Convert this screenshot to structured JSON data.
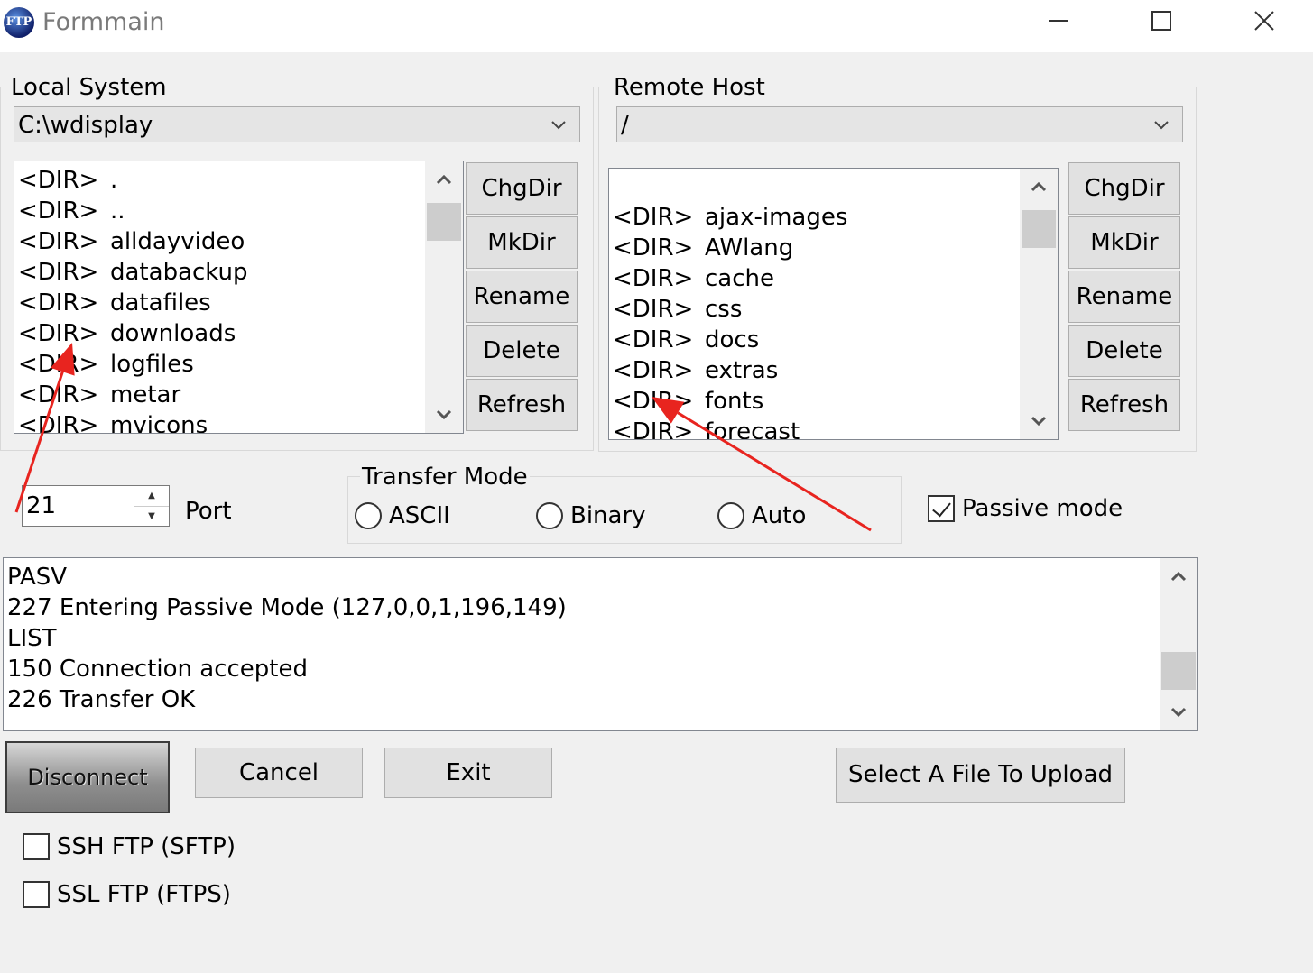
{
  "window": {
    "title": "Formmain",
    "app_icon_text": "FTP",
    "controls": [
      "minimize-icon",
      "maximize-icon",
      "close-icon"
    ]
  },
  "local": {
    "group_label": "Local System",
    "path": "C:\\wdisplay",
    "entries": [
      {
        "tag": "<DIR>",
        "name": "."
      },
      {
        "tag": "<DIR>",
        "name": ".."
      },
      {
        "tag": "<DIR>",
        "name": "alldayvideo"
      },
      {
        "tag": "<DIR>",
        "name": "databackup"
      },
      {
        "tag": "<DIR>",
        "name": "datafiles"
      },
      {
        "tag": "<DIR>",
        "name": "downloads"
      },
      {
        "tag": "<DIR>",
        "name": "logfiles"
      },
      {
        "tag": "<DIR>",
        "name": "metar"
      },
      {
        "tag": "<DIR>",
        "name": "mvicons"
      }
    ],
    "buttons": [
      "ChgDir",
      "MkDir",
      "Rename",
      "Delete",
      "Refresh"
    ]
  },
  "remote": {
    "group_label": "Remote Host",
    "path": "/",
    "entries": [
      {
        "tag": "<DIR>",
        "name": "ajax-images"
      },
      {
        "tag": "<DIR>",
        "name": "AWlang"
      },
      {
        "tag": "<DIR>",
        "name": "cache"
      },
      {
        "tag": "<DIR>",
        "name": "css"
      },
      {
        "tag": "<DIR>",
        "name": "docs"
      },
      {
        "tag": "<DIR>",
        "name": "extras"
      },
      {
        "tag": "<DIR>",
        "name": "fonts"
      },
      {
        "tag": "<DIR>",
        "name": "forecast"
      }
    ],
    "buttons": [
      "ChgDir",
      "MkDir",
      "Rename",
      "Delete",
      "Refresh"
    ]
  },
  "port": {
    "value": "21",
    "label": "Port"
  },
  "transfer_mode": {
    "label": "Transfer Mode",
    "options": [
      "ASCII",
      "Binary",
      "Auto"
    ]
  },
  "passive": {
    "label": "Passive mode",
    "checked": true
  },
  "log": {
    "lines": [
      "PASV",
      "227 Entering Passive Mode (127,0,0,1,196,149)",
      "LIST",
      "150 Connection accepted",
      "226 Transfer OK"
    ]
  },
  "actions": {
    "disconnect": "Disconnect",
    "cancel": "Cancel",
    "exit": "Exit",
    "upload": "Select A File To Upload"
  },
  "options": {
    "sftp": "SSH FTP (SFTP)",
    "ftps": "SSL FTP (FTPS)"
  },
  "annotation_color": "#e8241f"
}
